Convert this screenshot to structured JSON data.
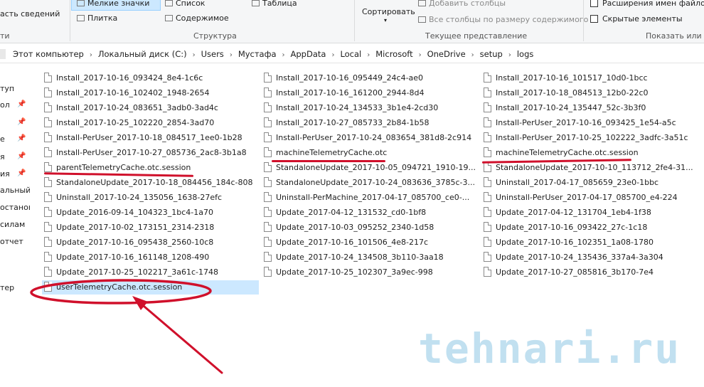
{
  "ribbon": {
    "left_action": "асть сведений",
    "left_group": "ти",
    "layout_options": {
      "small_icons": "Мелкие значки",
      "list": "Список",
      "table": "Таблица",
      "tiles": "Плитка",
      "content": "Содержимое"
    },
    "structure_group": "Структура",
    "sort_label": "Сортировать",
    "add_columns": "Добавить столбцы",
    "fit_columns": "Все столбцы по размеру содержимого",
    "current_view_group": "Текущее представление",
    "file_extensions": "Расширения имен файлов",
    "hidden_items": "Скрытые элементы",
    "show_hide_group": "Показать или с"
  },
  "breadcrumb": [
    "Этот компьютер",
    "Локальный диск (C:)",
    "Users",
    "Мустафа",
    "AppData",
    "Local",
    "Microsoft",
    "OneDrive",
    "setup",
    "logs"
  ],
  "nav": [
    "туп",
    "ол",
    "е",
    "я",
    "ия",
    "альный",
    "останов",
    "силам",
    "отчет",
    "тер"
  ],
  "files": {
    "col1": [
      "Install_2017-10-16_093424_8e4-1c6c",
      "Install_2017-10-16_102402_1948-2654",
      "Install_2017-10-24_083651_3adb0-3ad4c",
      "Install_2017-10-25_102220_2854-3ad70",
      "Install-PerUser_2017-10-18_084517_1ee0-1b28",
      "Install-PerUser_2017-10-27_085736_2ac8-3b1a8",
      "parentTelemetryCache.otc.session",
      "StandaloneUpdate_2017-10-18_084456_184c-808",
      "Uninstall_2017-10-24_135056_1638-27efc",
      "Update_2016-09-14_104323_1bc4-1a70",
      "Update_2017-10-02_173151_2314-2318",
      "Update_2017-10-16_095438_2560-10c8",
      "Update_2017-10-16_161148_1208-490",
      "Update_2017-10-25_102217_3a61c-1748",
      "userTelemetryCache.otc.session"
    ],
    "col2": [
      "Install_2017-10-16_095449_24c4-ae0",
      "Install_2017-10-16_161200_2944-8d4",
      "Install_2017-10-24_134533_3b1e4-2cd30",
      "Install_2017-10-27_085733_2b84-1b58",
      "Install-PerUser_2017-10-24_083654_381d8-2c914",
      "machineTelemetryCache.otc",
      "StandaloneUpdate_2017-10-05_094721_1910-19...",
      "StandaloneUpdate_2017-10-24_083636_3785c-3...",
      "Uninstall-PerMachine_2017-04-17_085700_ce0-...",
      "Update_2017-04-12_131532_cd0-1bf8",
      "Update_2017-10-03_095252_2340-1d58",
      "Update_2017-10-16_101506_4e8-217c",
      "Update_2017-10-24_134508_3b110-3aa18",
      "Update_2017-10-25_102307_3a9ec-998"
    ],
    "col3": [
      "Install_2017-10-16_101517_10d0-1bcc",
      "Install_2017-10-18_084513_12b0-22c0",
      "Install_2017-10-24_135447_52c-3b3f0",
      "Install-PerUser_2017-10-16_093425_1e54-a5c",
      "Install-PerUser_2017-10-25_102222_3adfc-3a51c",
      "machineTelemetryCache.otc.session",
      "StandaloneUpdate_2017-10-10_113712_2fe4-31...",
      "Uninstall_2017-04-17_085659_23e0-1bbc",
      "Uninstall-PerUser_2017-04-17_085700_e4-224",
      "Update_2017-04-12_131704_1eb4-1f38",
      "Update_2017-10-16_093422_27c-1c18",
      "Update_2017-10-16_102351_1a08-1780",
      "Update_2017-10-24_135436_337a4-3a304",
      "Update_2017-10-27_085816_3b170-7e4"
    ]
  },
  "selected_file": "userTelemetryCache.otc.session",
  "watermark": "tehnari.ru",
  "colors": {
    "annotation": "#d0102b",
    "selection": "#cce8ff",
    "watermark": "#b7dbee"
  }
}
